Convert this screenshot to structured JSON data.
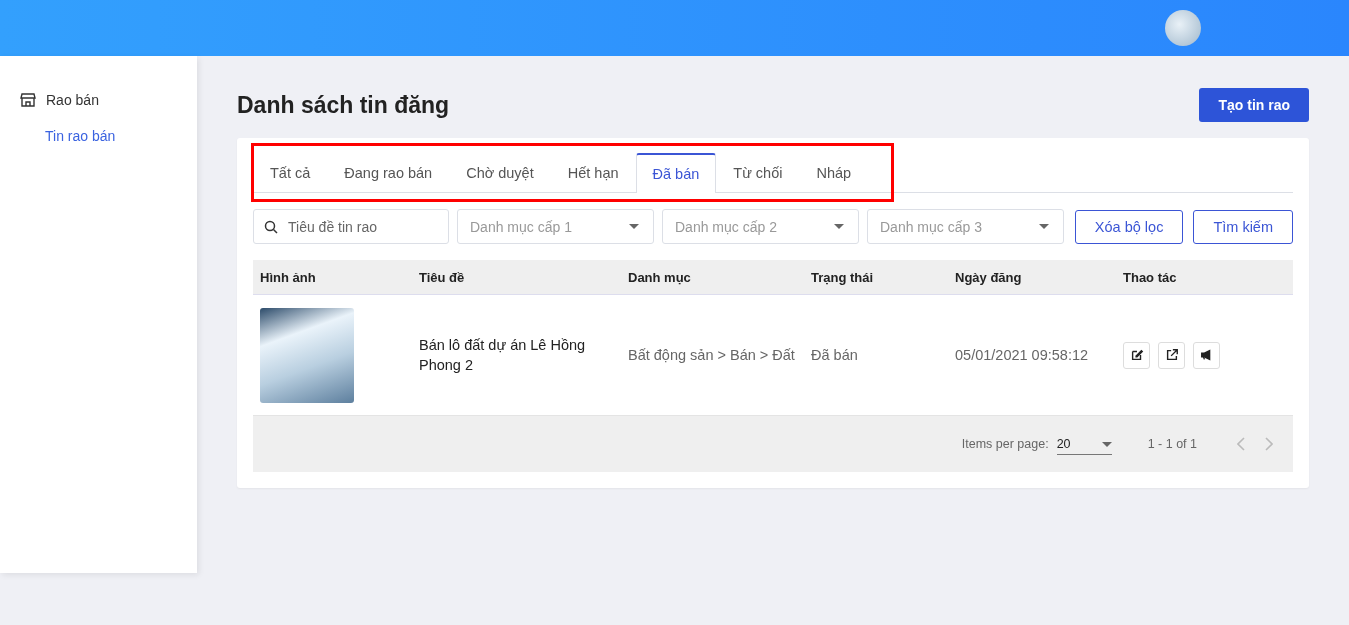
{
  "sidebar": {
    "items": [
      {
        "label": "Rao bán",
        "kind": "group",
        "children": [
          {
            "label": "Tin rao bán",
            "selected": true
          }
        ]
      }
    ]
  },
  "page_title": "Danh sách tin đăng",
  "create_button": "Tạo tin rao",
  "tabs": [
    {
      "label": "Tất cả",
      "selected": false
    },
    {
      "label": "Đang rao bán",
      "selected": false
    },
    {
      "label": "Chờ duyệt",
      "selected": false
    },
    {
      "label": "Hết hạn",
      "selected": false
    },
    {
      "label": "Đã bán",
      "selected": true
    },
    {
      "label": "Từ chối",
      "selected": false
    },
    {
      "label": "Nháp",
      "selected": false
    }
  ],
  "filters": {
    "search": {
      "placeholder": "Tiêu đề tin rao"
    },
    "selects": [
      {
        "placeholder": "Danh mục cấp 1"
      },
      {
        "placeholder": "Danh mục cấp 2"
      },
      {
        "placeholder": "Danh mục cấp 3"
      }
    ],
    "buttons": [
      "Xóa bộ lọc",
      "Tìm kiếm"
    ]
  },
  "table": {
    "columns": [
      "Hình ảnh",
      "Tiêu đề",
      "Danh mục",
      "Trạng thái",
      "Ngày đăng",
      "Thao tác"
    ],
    "rows": [
      {
        "title": "Bán lô đất dự án Lê Hồng Phong 2",
        "category": "Bất động sản > Bán > Đất",
        "status": "Đã bán",
        "date": "05/01/2021 09:58:12",
        "actions": [
          {
            "kind": "edit"
          },
          {
            "kind": "external"
          },
          {
            "kind": "promote"
          }
        ]
      }
    ]
  },
  "paginator": {
    "label": "Items per page:",
    "page_size": "20",
    "range": "1 - 1 of 1"
  }
}
